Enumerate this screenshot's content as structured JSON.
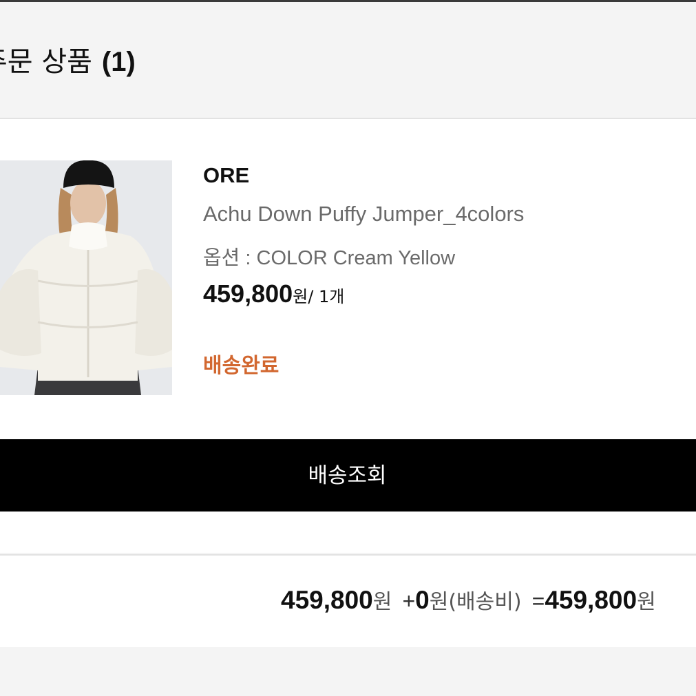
{
  "section": {
    "title": "주문 상품",
    "count": "(1)"
  },
  "item": {
    "brand": "ORE",
    "name": "Achu Down Puffy Jumper_4colors",
    "option": "옵션 : COLOR Cream Yellow",
    "price": "459,800",
    "price_unit": "원",
    "quantity": "/ 1개",
    "status": "배송완료",
    "status_color": "#d2672f",
    "image_icon": "product-photo-white-puffer-jacket"
  },
  "actions": {
    "track_label": "배송조회"
  },
  "total": {
    "product_amount": "459,800",
    "product_unit": "원",
    "shipping_prefix": "+",
    "shipping_amount": "0",
    "shipping_label": "원(배송비)",
    "equals": "=",
    "grand_amount": "459,800",
    "grand_unit": "원"
  }
}
